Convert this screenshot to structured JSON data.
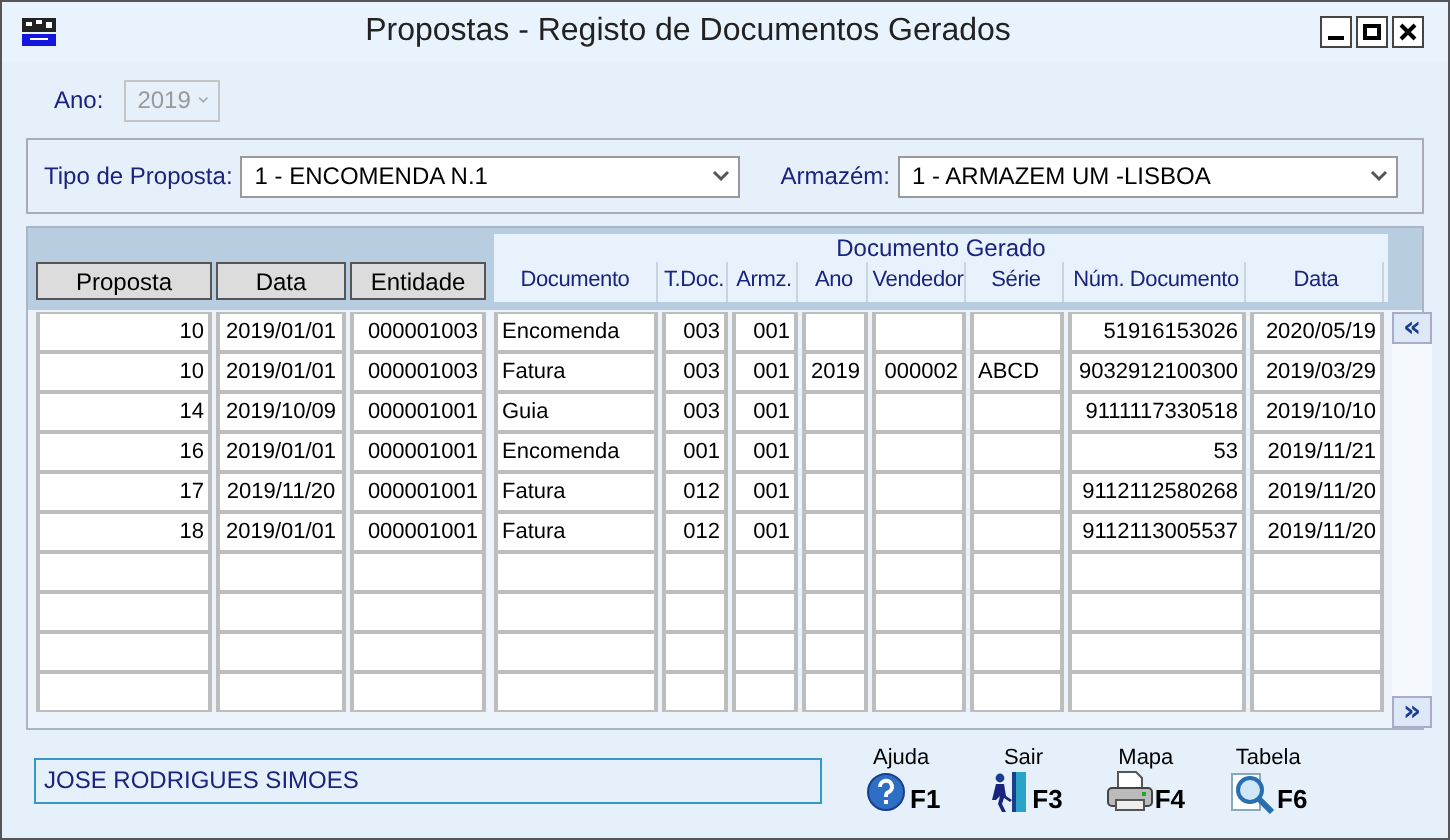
{
  "window": {
    "title": "Propostas - Registo de Documentos Gerados"
  },
  "year": {
    "label": "Ano:",
    "value": "2019",
    "disabled": true
  },
  "filters": [
    {
      "label": "Tipo de Proposta:",
      "value": "1 - ENCOMENDA N.1"
    },
    {
      "label": "Armazém:",
      "value": "1 - ARMAZEM UM -LISBOA"
    }
  ],
  "table": {
    "group_title": "Documento Gerado",
    "columns": [
      {
        "label": "Proposta",
        "kind": "button"
      },
      {
        "label": "Data",
        "kind": "button"
      },
      {
        "label": "Entidade",
        "kind": "button"
      },
      {
        "label": "Documento",
        "kind": "label"
      },
      {
        "label": "T.Doc.",
        "kind": "label"
      },
      {
        "label": "Armz.",
        "kind": "label"
      },
      {
        "label": "Ano",
        "kind": "label"
      },
      {
        "label": "Vendedor",
        "kind": "label"
      },
      {
        "label": "Série",
        "kind": "label"
      },
      {
        "label": "Núm. Documento",
        "kind": "label"
      },
      {
        "label": "Data",
        "kind": "label"
      }
    ],
    "rows": [
      [
        "10",
        "2019/01/01",
        "000001003",
        "Encomenda",
        "003",
        "001",
        null,
        null,
        null,
        "51916153026",
        "2020/05/19"
      ],
      [
        "10",
        "2019/01/01",
        "000001003",
        "Fatura",
        "003",
        "001",
        "2019",
        "000002",
        "ABCD",
        "9032912100300",
        "2019/03/29"
      ],
      [
        "14",
        "2019/10/09",
        "000001001",
        "Guia",
        "003",
        "001",
        null,
        null,
        null,
        "9111117330518",
        "2019/10/10"
      ],
      [
        "16",
        "2019/01/01",
        "000001001",
        "Encomenda",
        "001",
        "001",
        null,
        null,
        null,
        "53",
        "2019/11/21"
      ],
      [
        "17",
        "2019/11/20",
        "000001001",
        "Fatura",
        "012",
        "001",
        null,
        null,
        null,
        "9112112580268",
        "2019/11/20"
      ],
      [
        "18",
        "2019/01/01",
        "000001001",
        "Fatura",
        "012",
        "001",
        null,
        null,
        null,
        "9112113005537",
        "2019/11/20"
      ]
    ],
    "scroll_up": "«",
    "scroll_down": "»"
  },
  "status_field": {
    "value": "JOSE RODRIGUES SIMOES"
  },
  "actions": [
    {
      "label": "Ajuda",
      "key": "F1",
      "kind": "help"
    },
    {
      "label": "Sair",
      "key": "F3",
      "kind": "exit"
    },
    {
      "label": "Mapa",
      "key": "F4",
      "kind": "print"
    },
    {
      "label": "Tabela",
      "key": "F6",
      "kind": "search"
    }
  ]
}
